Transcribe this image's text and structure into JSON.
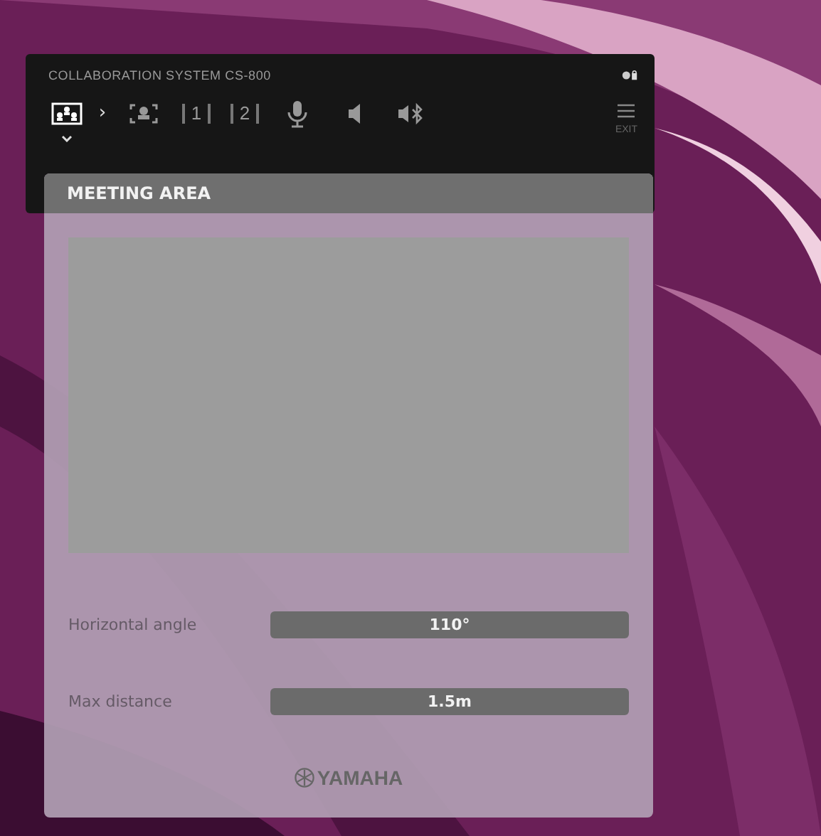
{
  "window": {
    "title": "COLLABORATION SYSTEM CS-800"
  },
  "toolbar": {
    "modes": [
      {
        "kind": "meeting",
        "selected": true
      },
      {
        "kind": "chevron",
        "text": "›"
      },
      {
        "kind": "speaker",
        "selected": false
      },
      {
        "kind": "preset1",
        "text": "1",
        "selected": false
      },
      {
        "kind": "preset2",
        "text": "2",
        "selected": false
      },
      {
        "kind": "mic",
        "selected": false
      },
      {
        "kind": "volume",
        "selected": false
      },
      {
        "kind": "bluetooth",
        "selected": false
      }
    ],
    "exit": {
      "label": "EXIT"
    }
  },
  "panel": {
    "title": "MEETING AREA",
    "settings": [
      {
        "label": "Horizontal angle",
        "value": "110°"
      },
      {
        "label": "Max distance",
        "value": "1.5m"
      }
    ],
    "brand": "YAMAHA"
  }
}
